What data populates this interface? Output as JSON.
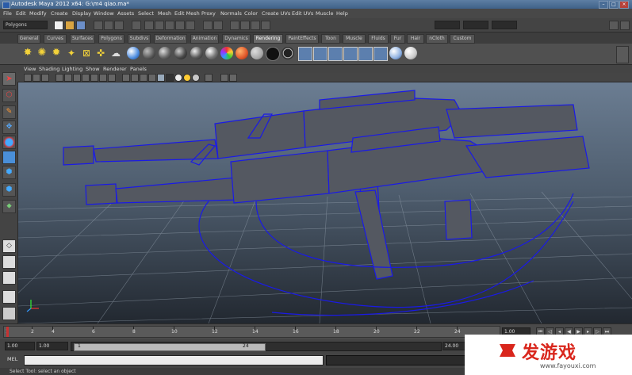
{
  "window": {
    "title": "Autodesk Maya 2012 x64: G:\\m4  qiao.ma*"
  },
  "menubar": {
    "items": [
      "File",
      "Edit",
      "Modify",
      "Create",
      "Display",
      "Window",
      "Assets",
      "Select",
      "Mesh",
      "Edit Mesh",
      "Proxy",
      "Normals",
      "Color",
      "Create UVs",
      "Edit UVs",
      "Muscle",
      "Help"
    ]
  },
  "statusline": {
    "menuset": "Polygons"
  },
  "shelf": {
    "tabs": [
      "General",
      "Curves",
      "Surfaces",
      "Polygons",
      "Subdivs",
      "Deformation",
      "Animation",
      "Dynamics",
      "Rendering",
      "PaintEffects",
      "Toon",
      "Muscle",
      "Fluids",
      "Fur",
      "Hair",
      "nCloth",
      "Custom"
    ],
    "active_tab": "Rendering"
  },
  "panel": {
    "menus": [
      "View",
      "Shading",
      "Lighting",
      "Show",
      "Renderer",
      "Panels"
    ]
  },
  "timeline": {
    "ticks": [
      "1",
      "2",
      "4",
      "6",
      "8",
      "10",
      "12",
      "14",
      "16",
      "18",
      "20",
      "22",
      "24"
    ],
    "current_frame": "1.00"
  },
  "range": {
    "start_time": "1.00",
    "playback_start": "1.00",
    "range_start_label": "1",
    "range_end_label": "24",
    "end_time": "24.00"
  },
  "commandline": {
    "label": "MEL"
  },
  "helpline": {
    "text": "Select Tool: select an object"
  },
  "watermark": {
    "logo_text": "发游戏",
    "url": "www.fayouxi.com"
  },
  "colors": {
    "wire": "#1a1ae6",
    "viewport_top": "#6b7d92",
    "watermark_red": "#d9261c"
  }
}
